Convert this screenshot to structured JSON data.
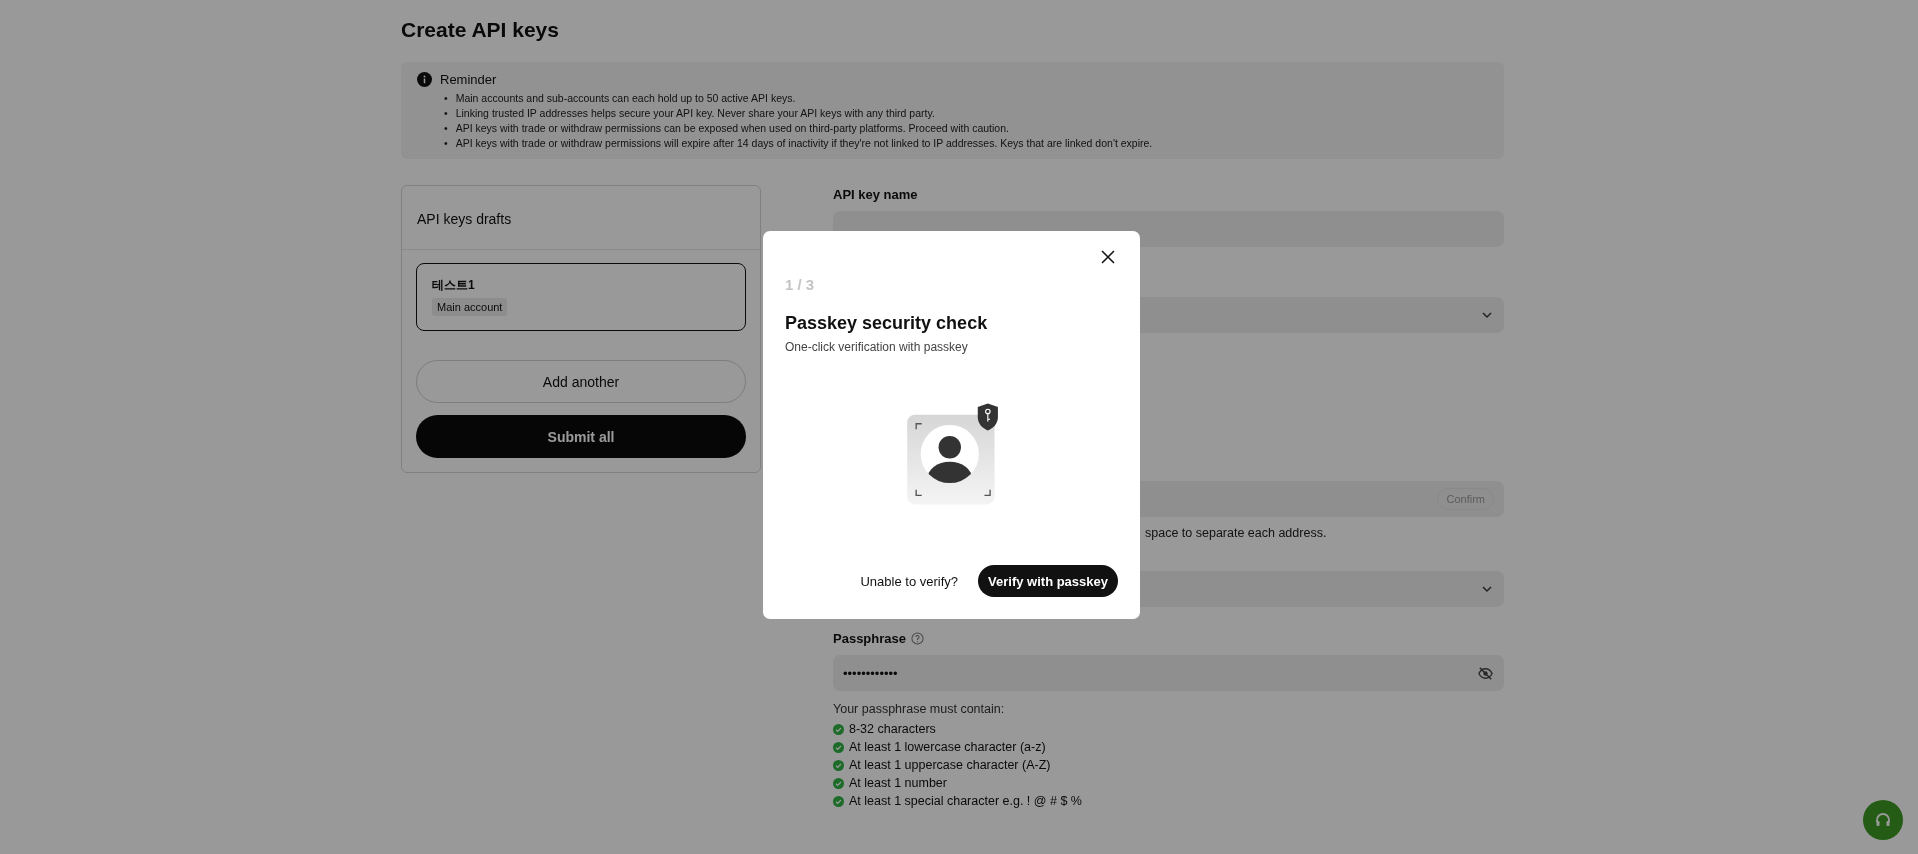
{
  "page": {
    "title": "Create API keys"
  },
  "reminder": {
    "title": "Reminder",
    "items": [
      {
        "bullet": "•",
        "text": "Main accounts and sub-accounts can each hold up to 50 active API keys."
      },
      {
        "bullet": "•",
        "text": "Linking trusted IP addresses helps secure your API key. Never share your API keys with any third party."
      },
      {
        "bullet": "•",
        "text": "API keys with trade or withdraw permissions can be exposed when used on third-party platforms. Proceed with caution."
      },
      {
        "bullet": "•",
        "text": "API keys with trade or withdraw permissions will expire after 14 days of inactivity if they're not linked to IP addresses. Keys that are linked don't expire."
      }
    ]
  },
  "drafts": {
    "title": "API keys drafts",
    "items": [
      {
        "name": "테스트1",
        "account": "Main account",
        "selected": true
      }
    ],
    "add_button": "Add another",
    "submit_button": "Submit all"
  },
  "form": {
    "name_field": {
      "label": "API key name"
    },
    "ip_field": {
      "button": "Confirm",
      "helper": "space to separate each address."
    },
    "passphrase": {
      "label": "Passphrase",
      "value": "••••••••••••",
      "hint": "Your passphrase must contain:",
      "rules": [
        {
          "text": "8-32 characters",
          "met": true
        },
        {
          "text": "At least 1 lowercase character (a-z)",
          "met": true
        },
        {
          "text": "At least 1 uppercase character (A-Z)",
          "met": true
        },
        {
          "text": "At least 1 number",
          "met": true
        },
        {
          "text": "At least 1 special character e.g. ! @ # $ %",
          "met": true
        }
      ]
    }
  },
  "modal": {
    "step": "1 / 3",
    "title": "Passkey security check",
    "subtitle": "One-click verification with passkey",
    "secondary_button": "Unable to verify?",
    "primary_button": "Verify with passkey"
  }
}
